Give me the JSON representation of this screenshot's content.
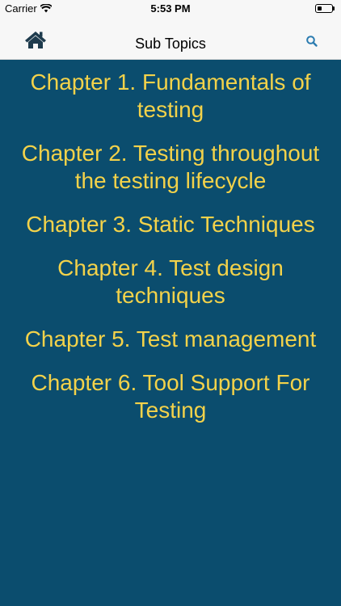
{
  "status_bar": {
    "carrier": "Carrier",
    "time": "5:53 PM",
    "wifi_icon": "wifi-icon",
    "battery_icon": "battery-icon",
    "battery_level": 0.2
  },
  "nav_bar": {
    "title": "Sub Topics",
    "home_icon": "home-icon",
    "search_icon": "search-icon"
  },
  "topics": [
    "Chapter 1. Fundamentals of testing",
    "Chapter 2. Testing throughout the testing lifecycle",
    "Chapter 3. Static Techniques",
    "Chapter 4. Test design techniques",
    "Chapter 5. Test management",
    "Chapter 6. Tool Support For Testing"
  ],
  "colors": {
    "background": "#0b4d6e",
    "topic_text": "#f3d24a",
    "nav_background": "#f7f7f7",
    "home_icon": "#1e3b4d",
    "search_icon": "#2a7bb0"
  }
}
